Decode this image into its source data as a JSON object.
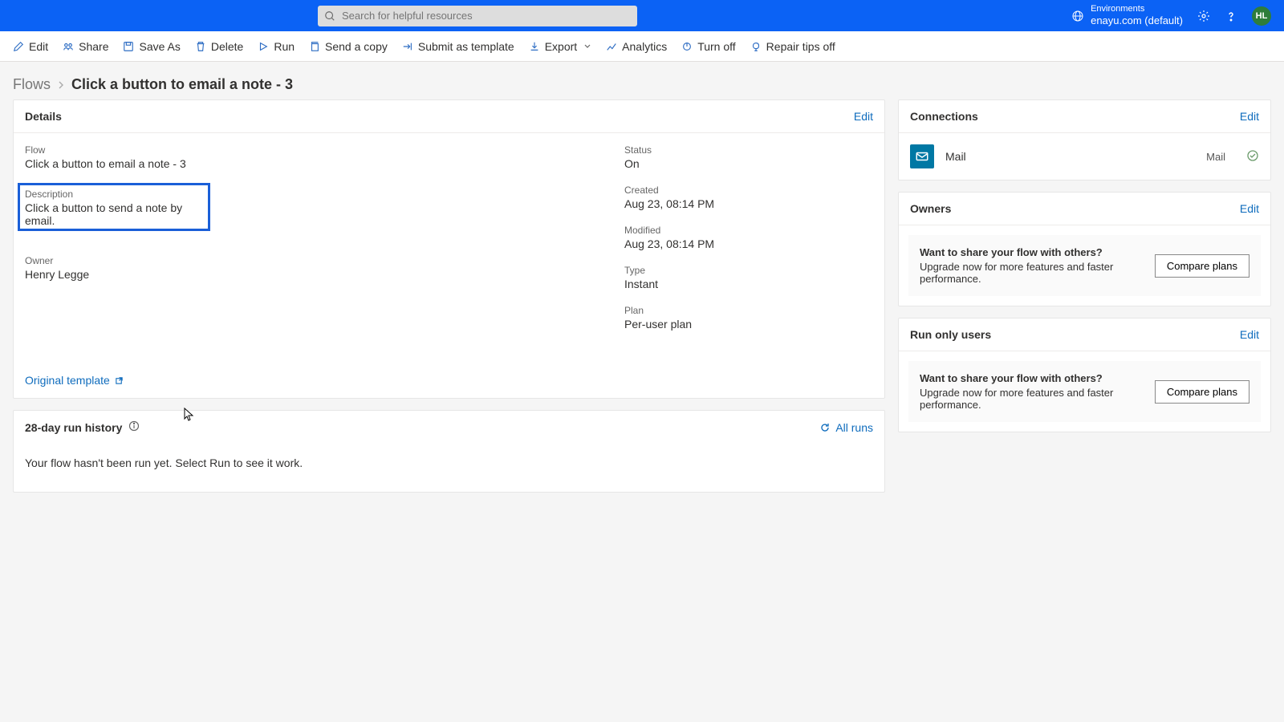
{
  "header": {
    "search_placeholder": "Search for helpful resources",
    "env_label": "Environments",
    "env_value": "enayu.com (default)",
    "avatar_initials": "HL"
  },
  "toolbar": {
    "edit": "Edit",
    "share": "Share",
    "save_as": "Save As",
    "delete": "Delete",
    "run": "Run",
    "send_copy": "Send a copy",
    "submit_template": "Submit as template",
    "export": "Export",
    "analytics": "Analytics",
    "turn_off": "Turn off",
    "repair_tips_off": "Repair tips off"
  },
  "breadcrumb": {
    "root": "Flows",
    "current": "Click a button to email a note - 3"
  },
  "details": {
    "title": "Details",
    "edit": "Edit",
    "flow_label": "Flow",
    "flow_value": "Click a button to email a note - 3",
    "description_label": "Description",
    "description_value": "Click a button to send a note by email.",
    "owner_label": "Owner",
    "owner_value": "Henry Legge",
    "status_label": "Status",
    "status_value": "On",
    "created_label": "Created",
    "created_value": "Aug 23, 08:14 PM",
    "modified_label": "Modified",
    "modified_value": "Aug 23, 08:14 PM",
    "type_label": "Type",
    "type_value": "Instant",
    "plan_label": "Plan",
    "plan_value": "Per-user plan",
    "original_template": "Original template"
  },
  "history": {
    "title": "28-day run history",
    "all_runs": "All runs",
    "empty_text": "Your flow hasn't been run yet. Select Run to see it work."
  },
  "connections": {
    "title": "Connections",
    "edit": "Edit",
    "items": [
      {
        "name": "Mail",
        "type": "Mail"
      }
    ]
  },
  "owners": {
    "title": "Owners",
    "edit": "Edit",
    "promo_title": "Want to share your flow with others?",
    "promo_text": "Upgrade now for more features and faster performance.",
    "compare": "Compare plans"
  },
  "run_only": {
    "title": "Run only users",
    "edit": "Edit",
    "promo_title": "Want to share your flow with others?",
    "promo_text": "Upgrade now for more features and faster performance.",
    "compare": "Compare plans"
  }
}
